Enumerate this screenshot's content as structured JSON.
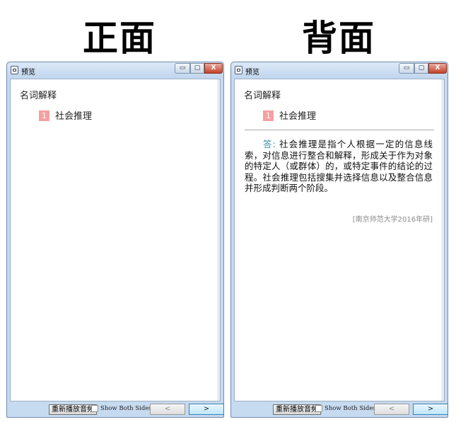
{
  "labels": {
    "front": "正面",
    "back": "背面"
  },
  "window": {
    "title": "预览",
    "controls": {
      "minimize": "▭",
      "maximize": "▢",
      "close": "X"
    }
  },
  "card": {
    "heading": "名词解释",
    "item_number": "1",
    "term": "社会推理",
    "answer_label": "答:",
    "answer_text": "社会推理是指个人根据一定的信息线索，对信息进行整合和解释，形成关于作为对象的特定人（或群体）的，或特定事件的结论的过程。社会推理包括搜集并选择信息以及整合信息并形成判断两个阶段。",
    "source": "[南京师范大学2016年研]"
  },
  "footer": {
    "replay_label": "重新播放音频",
    "show_both_label": "Show Both Sides",
    "prev_symbol": "<",
    "next_symbol": ">"
  },
  "colors": {
    "badge": "#f4a0a0",
    "answer_label": "#3a8ea8",
    "source": "#8a8a8a"
  }
}
